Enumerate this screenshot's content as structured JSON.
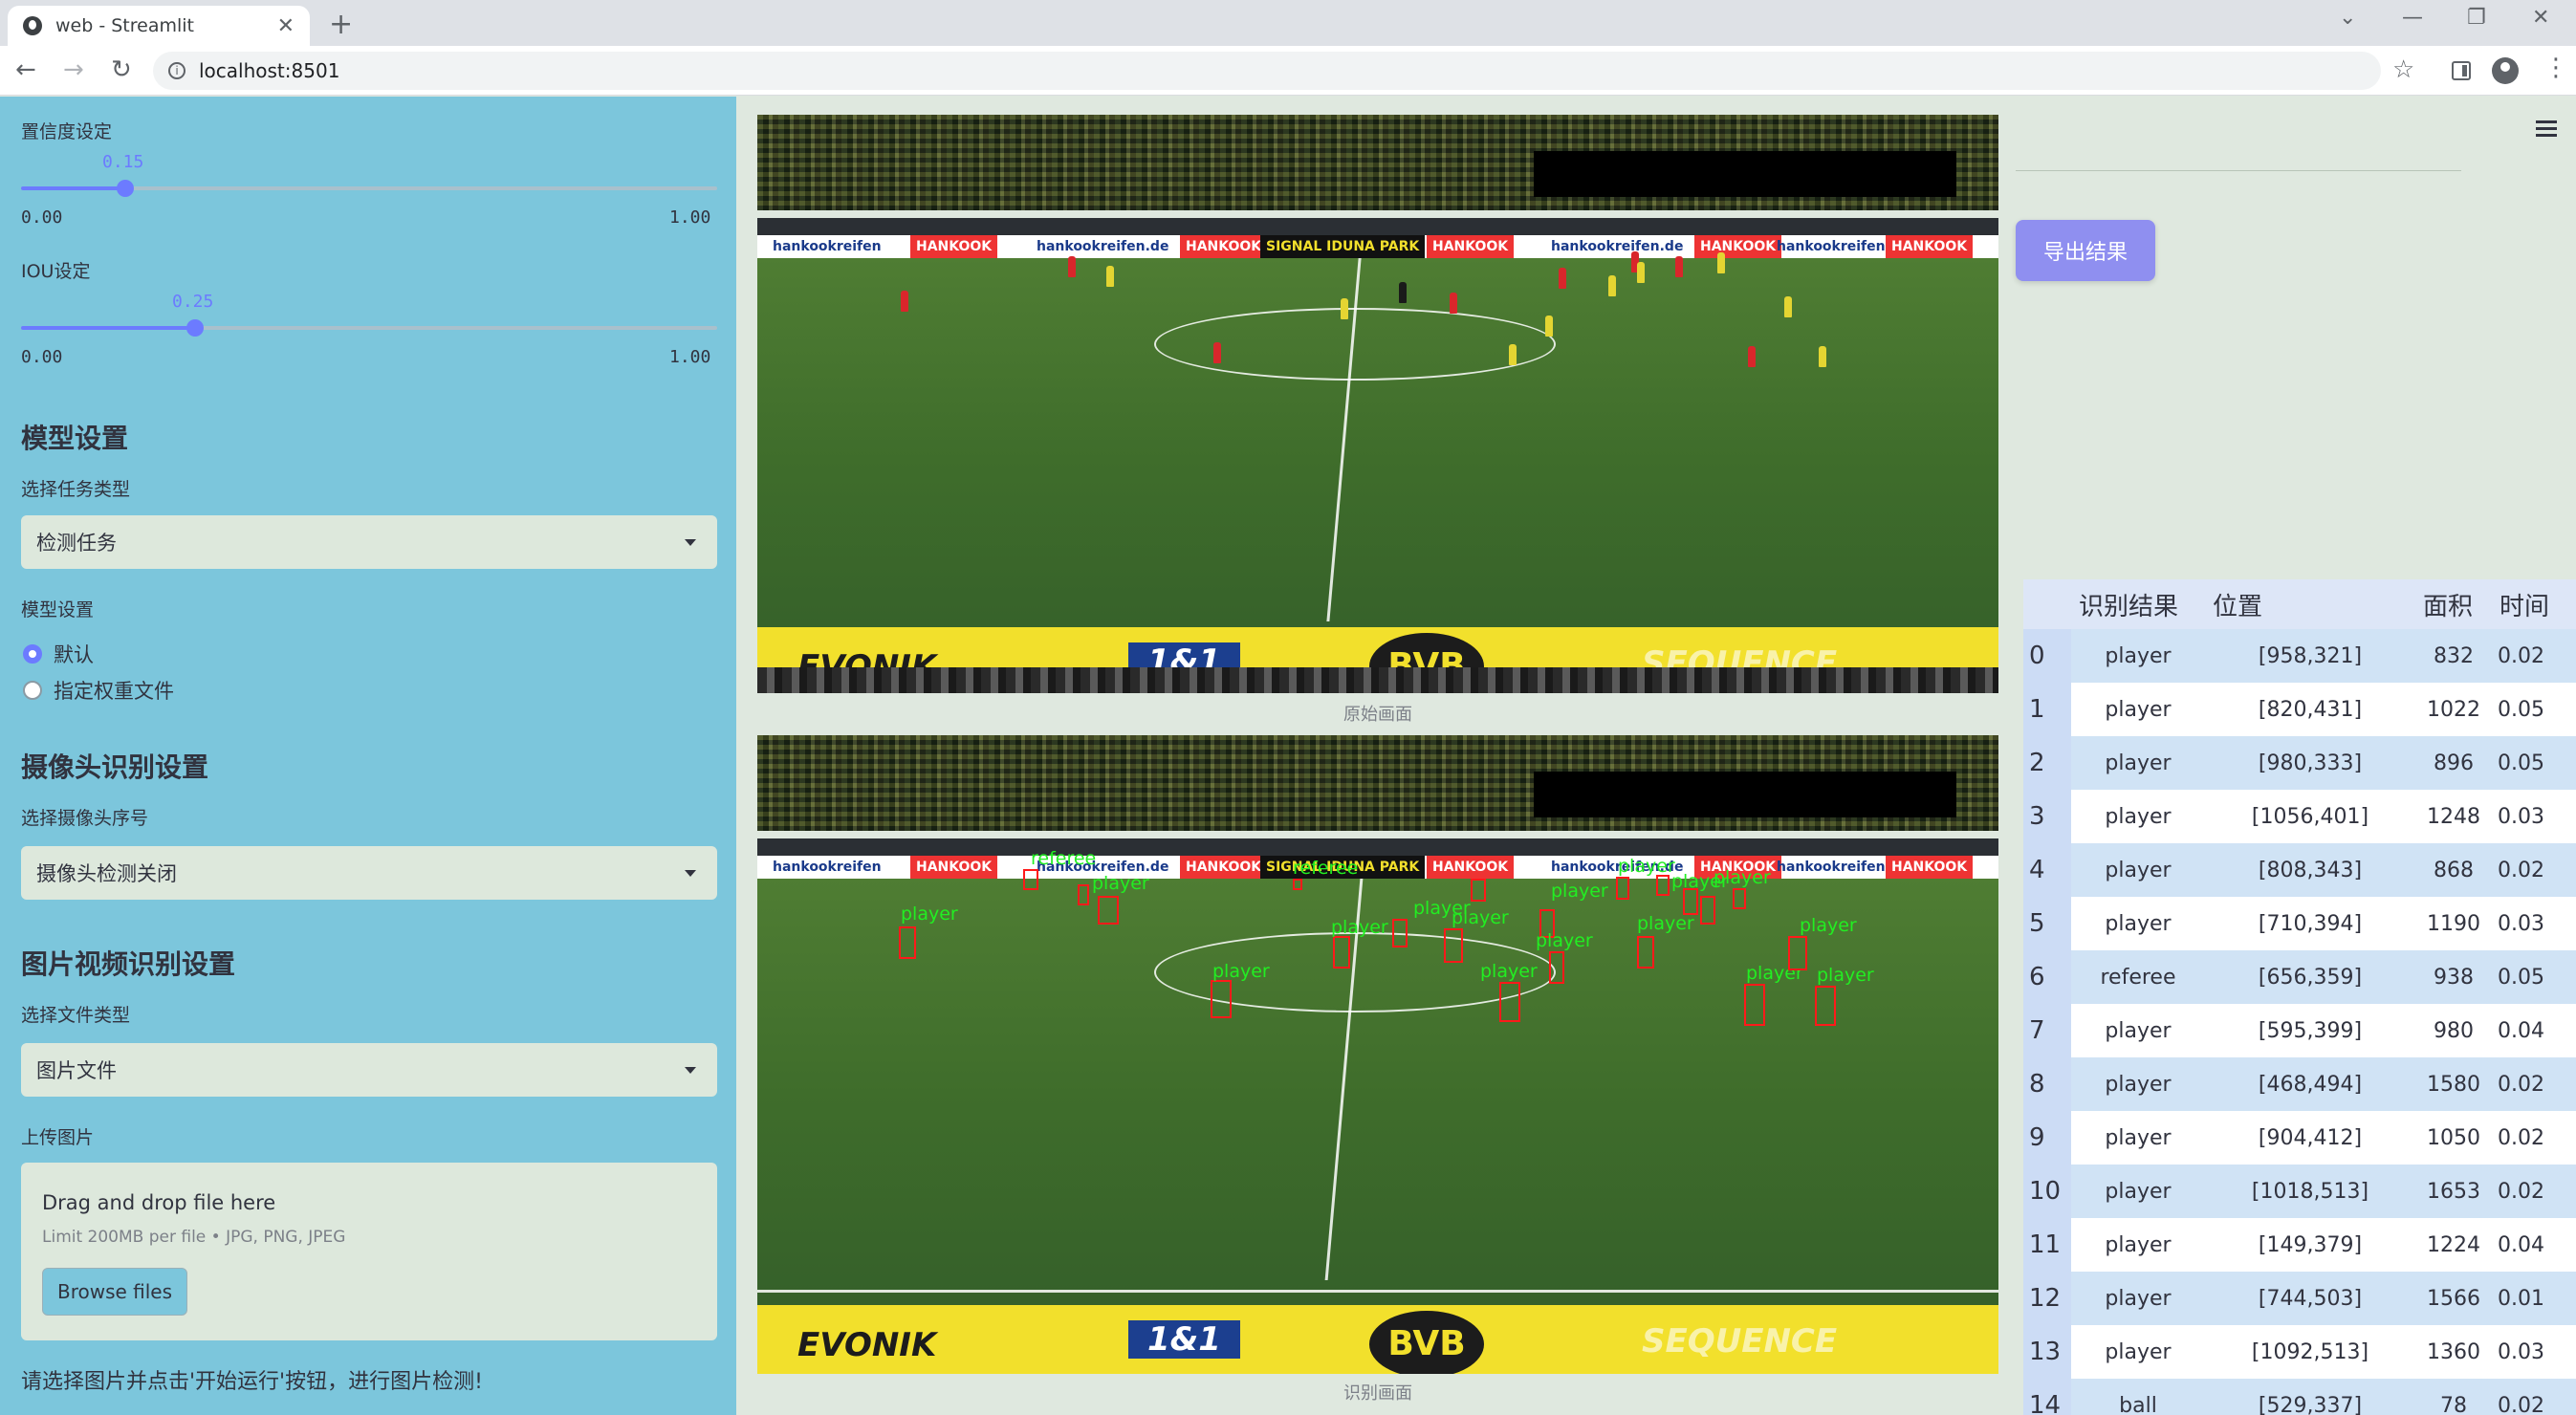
{
  "browser": {
    "tab_title": "web - Streamlit",
    "url": "localhost:8501"
  },
  "sidebar": {
    "confidence": {
      "label": "置信度设定",
      "value": "0.15",
      "value_fraction": 0.15,
      "min": "0.00",
      "max": "1.00"
    },
    "iou": {
      "label": "IOU设定",
      "value": "0.25",
      "value_fraction": 0.25,
      "min": "0.00",
      "max": "1.00"
    },
    "model_heading": "模型设置",
    "task_label": "选择任务类型",
    "task_value": "检测任务",
    "model_label": "模型设置",
    "model_options": [
      "默认",
      "指定权重文件"
    ],
    "model_selected": "默认",
    "camera_heading": "摄像头识别设置",
    "camera_label": "选择摄像头序号",
    "camera_value": "摄像头检测关闭",
    "media_heading": "图片视频识别设置",
    "filetype_label": "选择文件类型",
    "filetype_value": "图片文件",
    "upload_label": "上传图片",
    "dropzone_title": "Drag and drop file here",
    "dropzone_sub": "Limit 200MB per file • JPG, PNG, JPEG",
    "browse_label": "Browse files",
    "hint": "请选择图片并点击'开始运行'按钮，进行图片检测!"
  },
  "main": {
    "original_caption": "原始画面",
    "result_caption": "识别画面",
    "export_label": "导出结果",
    "scene": {
      "led_ads": [
        "hankookreifen",
        "HANKOOK",
        "hankookreifen.de",
        "HANKOOK",
        "SIGNAL IDUNA PARK",
        "HANKOOK",
        "hankookreifen.de",
        "HANKOOK",
        "hankookreifen",
        "HANKOOK"
      ],
      "board_text": [
        "EVONIK",
        "1&1",
        "BVB",
        "SEQUENCE"
      ]
    },
    "detection_labels": [
      "player",
      "referee",
      "player",
      "player",
      "referee",
      "player",
      "player",
      "player",
      "player",
      "player",
      "player",
      "player",
      "player",
      "player",
      "player",
      "player",
      "player",
      "player"
    ]
  },
  "results": {
    "columns": [
      "识别结果",
      "位置",
      "面积",
      "时间"
    ],
    "rows": [
      {
        "idx": "0",
        "cls": "player",
        "pos": "[958,321]",
        "area": "832",
        "time": "0.02"
      },
      {
        "idx": "1",
        "cls": "player",
        "pos": "[820,431]",
        "area": "1022",
        "time": "0.05"
      },
      {
        "idx": "2",
        "cls": "player",
        "pos": "[980,333]",
        "area": "896",
        "time": "0.05"
      },
      {
        "idx": "3",
        "cls": "player",
        "pos": "[1056,401]",
        "area": "1248",
        "time": "0.03"
      },
      {
        "idx": "4",
        "cls": "player",
        "pos": "[808,343]",
        "area": "868",
        "time": "0.02"
      },
      {
        "idx": "5",
        "cls": "player",
        "pos": "[710,394]",
        "area": "1190",
        "time": "0.03"
      },
      {
        "idx": "6",
        "cls": "referee",
        "pos": "[656,359]",
        "area": "938",
        "time": "0.05"
      },
      {
        "idx": "7",
        "cls": "player",
        "pos": "[595,399]",
        "area": "980",
        "time": "0.04"
      },
      {
        "idx": "8",
        "cls": "player",
        "pos": "[468,494]",
        "area": "1580",
        "time": "0.02"
      },
      {
        "idx": "9",
        "cls": "player",
        "pos": "[904,412]",
        "area": "1050",
        "time": "0.02"
      },
      {
        "idx": "10",
        "cls": "player",
        "pos": "[1018,513]",
        "area": "1653",
        "time": "0.02"
      },
      {
        "idx": "11",
        "cls": "player",
        "pos": "[149,379]",
        "area": "1224",
        "time": "0.04"
      },
      {
        "idx": "12",
        "cls": "player",
        "pos": "[744,503]",
        "area": "1566",
        "time": "0.01"
      },
      {
        "idx": "13",
        "cls": "player",
        "pos": "[1092,513]",
        "area": "1360",
        "time": "0.03"
      },
      {
        "idx": "14",
        "cls": "ball",
        "pos": "[529,337]",
        "area": "78",
        "time": "0.02"
      }
    ]
  }
}
